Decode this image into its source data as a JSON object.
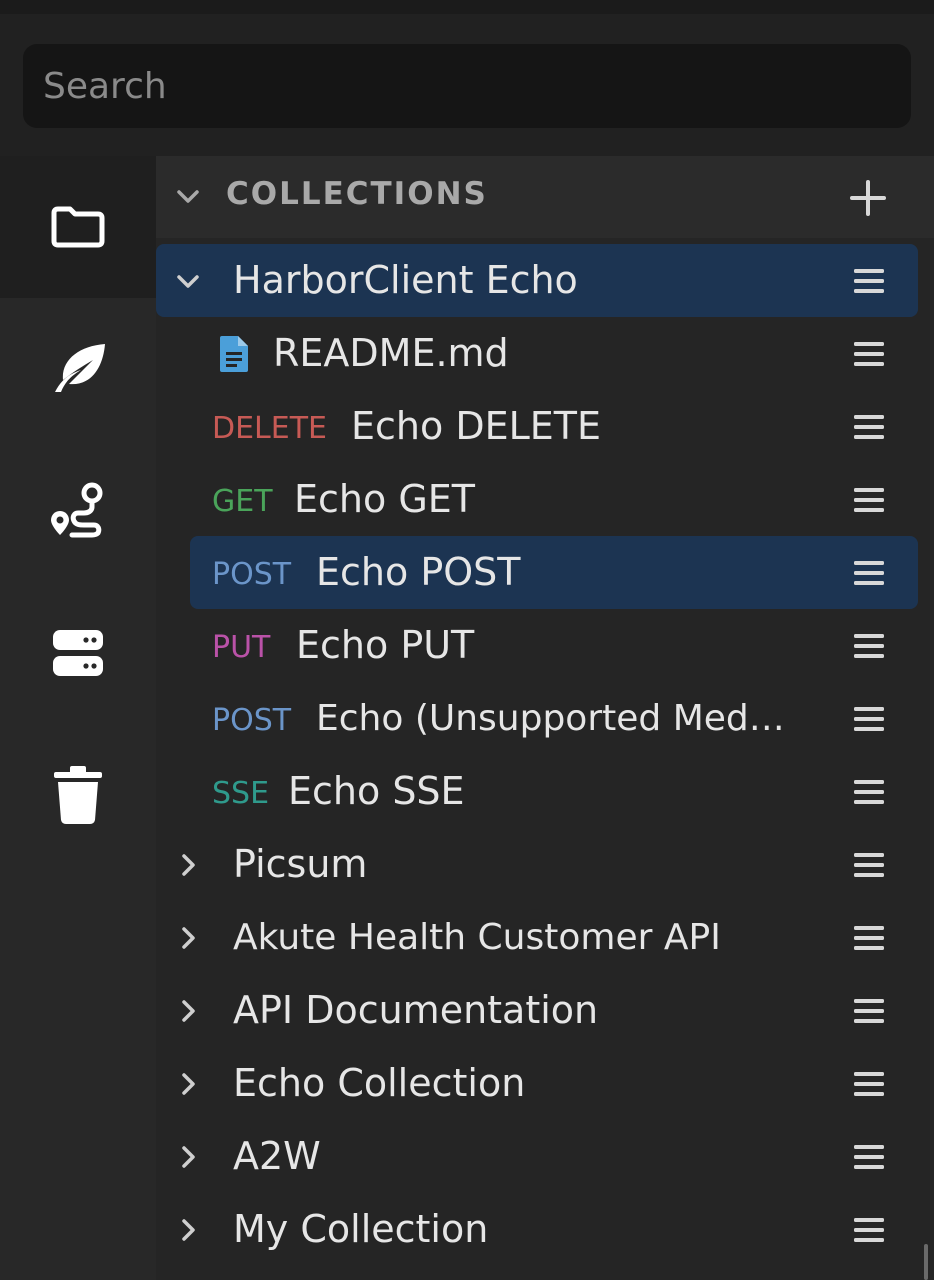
{
  "search": {
    "placeholder": "Search"
  },
  "rail": {
    "items": [
      {
        "icon": "folder-icon",
        "active": true
      },
      {
        "icon": "leaf-icon",
        "active": false
      },
      {
        "icon": "route-icon",
        "active": false
      },
      {
        "icon": "server-icon",
        "active": false
      },
      {
        "icon": "trash-icon",
        "active": false
      }
    ]
  },
  "collections": {
    "header": "COLLECTIONS",
    "add_icon": "plus-icon",
    "expanded": {
      "name": "HarborClient Echo",
      "children": [
        {
          "kind": "doc",
          "label": "README.md"
        },
        {
          "method": "DELETE",
          "label": "Echo DELETE"
        },
        {
          "method": "GET",
          "label": "Echo GET"
        },
        {
          "method": "POST",
          "label": "Echo POST",
          "selected": true
        },
        {
          "method": "PUT",
          "label": "Echo PUT"
        },
        {
          "method": "POST",
          "label": "Echo (Unsupported Med…"
        },
        {
          "method": "SSE",
          "label": "Echo SSE"
        }
      ]
    },
    "collapsed": [
      "Picsum",
      "Akute Health Customer API",
      "API Documentation",
      "Echo Collection",
      "A2W",
      "My Collection"
    ]
  },
  "colors": {
    "selected_bg": "#1c3452",
    "delete": "#c75a55",
    "get": "#4aa45a",
    "post": "#6b95c9",
    "put": "#ba52a8",
    "sse": "#2f9a8c",
    "doc_icon": "#4b9fd9"
  }
}
